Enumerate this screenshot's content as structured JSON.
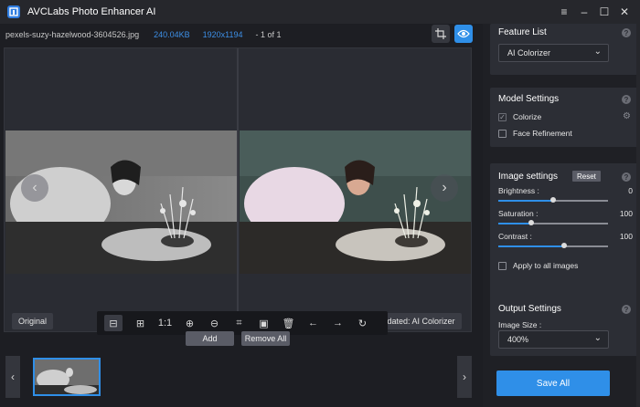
{
  "app": {
    "title": "AVCLabs Photo Enhancer AI"
  },
  "window_controls": {
    "menu": "≡",
    "minimize": "–",
    "maximize": "☐",
    "close": "✕"
  },
  "file_info": {
    "name": "pexels-suzy-hazelwood-3604526.jpg",
    "size": "240.04KB",
    "resolution": "1920x1194",
    "count": "- 1 of 1"
  },
  "viewer": {
    "original_label": "Original",
    "updated_label": "Updated: AI Colorizer",
    "nav_prev": "‹",
    "nav_next": "›"
  },
  "toolbar": {
    "items": [
      {
        "name": "split-view-icon",
        "glyph": "⊟"
      },
      {
        "name": "compare-view-icon",
        "glyph": "⊞"
      },
      {
        "name": "actual-size-button",
        "glyph": "1:1"
      },
      {
        "name": "zoom-in-icon",
        "glyph": "⊕"
      },
      {
        "name": "zoom-out-icon",
        "glyph": "⊖"
      },
      {
        "name": "crop-icon",
        "glyph": "⌗"
      },
      {
        "name": "save-icon",
        "glyph": "▣"
      },
      {
        "name": "delete-icon",
        "glyph": "🗑"
      },
      {
        "name": "arrow-left-icon",
        "glyph": "←"
      },
      {
        "name": "arrow-right-icon",
        "glyph": "→"
      },
      {
        "name": "refresh-icon",
        "glyph": "↻"
      }
    ]
  },
  "buttons": {
    "add": "Add",
    "remove_all": "Remove All"
  },
  "strip": {
    "prev": "‹",
    "next": "›"
  },
  "feature_list": {
    "title": "Feature List",
    "selected": "AI Colorizer"
  },
  "model_settings": {
    "title": "Model Settings",
    "options": [
      {
        "label": "Colorize",
        "checked": true
      },
      {
        "label": "Face Refinement",
        "checked": false
      }
    ]
  },
  "image_settings": {
    "title": "Image settings",
    "reset": "Reset",
    "sliders": [
      {
        "label": "Brightness :",
        "value": "0",
        "level": 0.5
      },
      {
        "label": "Saturation :",
        "value": "100",
        "level": 0.3
      },
      {
        "label": "Contrast :",
        "value": "100",
        "level": 0.6
      }
    ],
    "apply_all": "Apply to all images"
  },
  "output_settings": {
    "title": "Output Settings",
    "size_label": "Image Size :",
    "size_value": "400%"
  },
  "save_all": "Save All",
  "colors": {
    "accent": "#2f8fe8",
    "panel": "#2c2e35",
    "background": "#1f2025"
  }
}
